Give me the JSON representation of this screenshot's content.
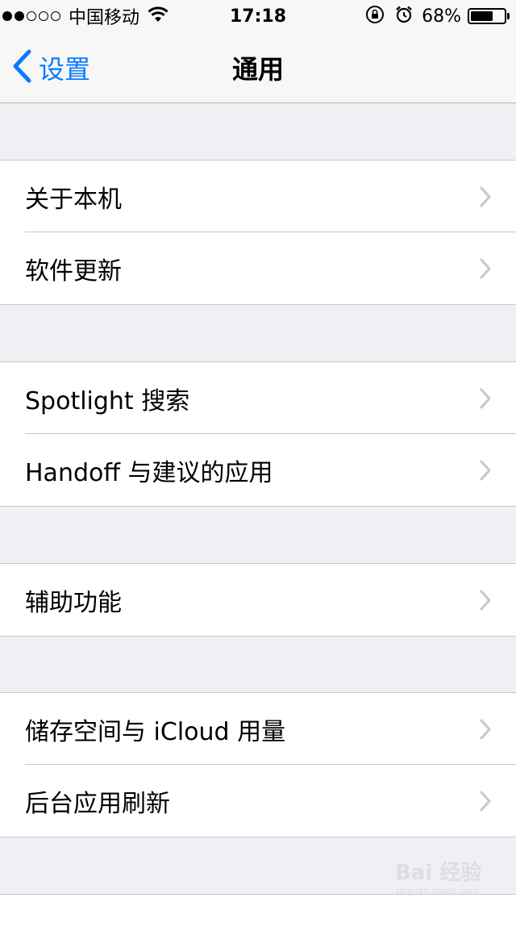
{
  "status_bar": {
    "carrier": "中国移动",
    "time": "17:18",
    "battery_percent": "68%",
    "battery_level": 0.68,
    "signal_bars_filled": 2,
    "signal_bars_total": 5,
    "icons": [
      "wifi-icon",
      "rotation-lock-icon",
      "alarm-icon",
      "battery-icon"
    ]
  },
  "nav": {
    "back_label": "设置",
    "title": "通用"
  },
  "groups": [
    {
      "items": [
        {
          "label": "关于本机"
        },
        {
          "label": "软件更新"
        }
      ]
    },
    {
      "items": [
        {
          "label": "Spotlight 搜索"
        },
        {
          "label": "Handoff 与建议的应用"
        }
      ]
    },
    {
      "items": [
        {
          "label": "辅助功能"
        }
      ]
    },
    {
      "items": [
        {
          "label": "储存空间与 iCloud 用量"
        },
        {
          "label": "后台应用刷新"
        }
      ]
    }
  ],
  "watermark": {
    "text": "Bai 经验",
    "subtext": "jingyan.baidu.com"
  },
  "colors": {
    "accent": "#0a7aff",
    "background": "#efeff4",
    "separator": "#c8c7cc",
    "chevron": "#c7c7cc"
  }
}
